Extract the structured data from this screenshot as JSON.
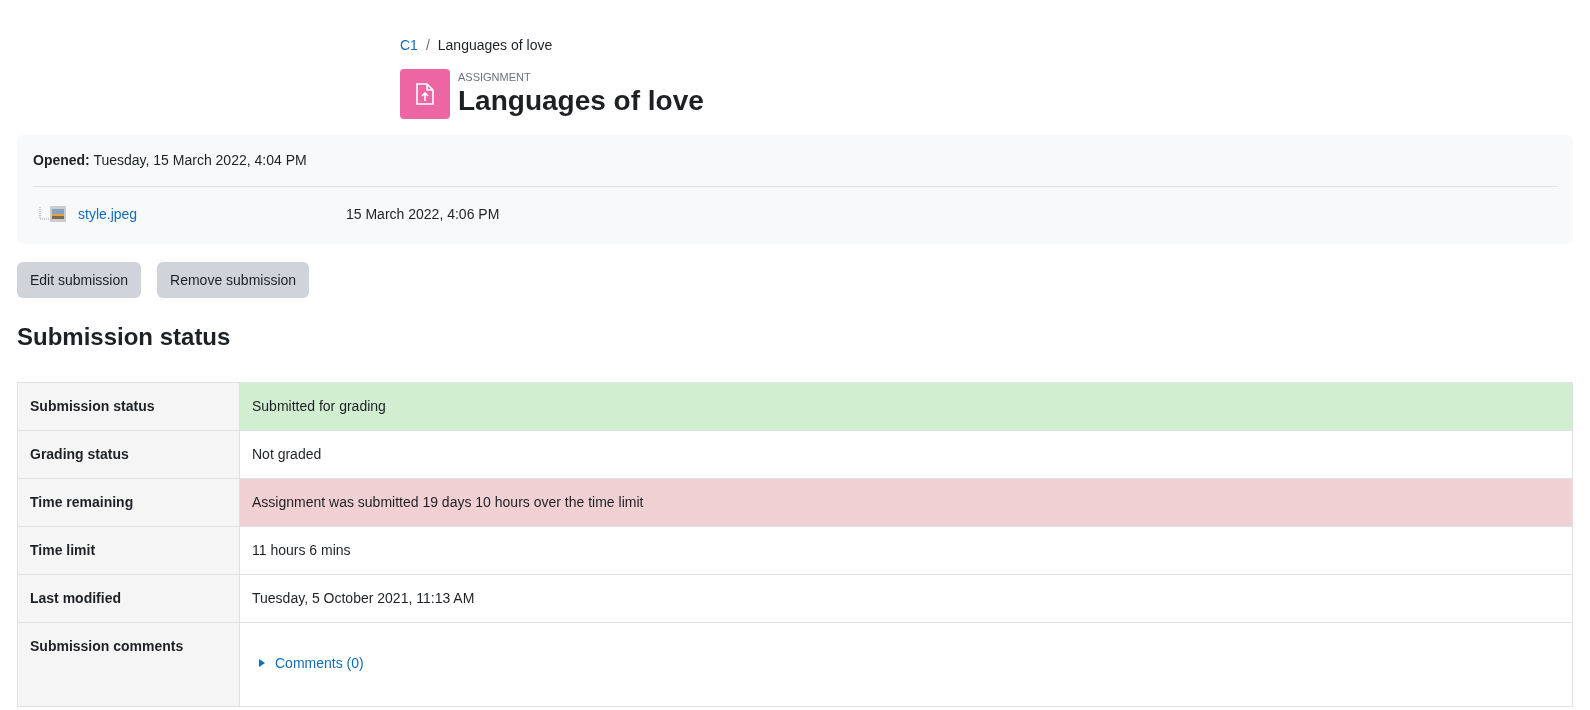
{
  "breadcrumb": [
    {
      "label": "C1",
      "link": true
    },
    {
      "label": "Languages of love",
      "link": false
    }
  ],
  "breadcrumb_separator": "/",
  "header": {
    "kicker": "ASSIGNMENT",
    "title": "Languages of love"
  },
  "dates": {
    "label": "Opened:",
    "value": "Tuesday, 15 March 2022, 4:04 PM"
  },
  "files": [
    {
      "name": "style.jpeg",
      "modified": "15 March 2022, 4:06 PM"
    }
  ],
  "buttons": [
    "Edit submission",
    "Remove submission"
  ],
  "section_title": "Submission status",
  "table": {
    "rows": [
      {
        "label": "Submission status",
        "value": "Submitted for grading",
        "color": "#d1eed1",
        "kind": "text"
      },
      {
        "label": "Grading status",
        "value": "Not graded",
        "kind": "text"
      },
      {
        "label": "Time remaining",
        "value": "Assignment was submitted 19 days 10 hours over the time limit",
        "color": "#f0d0d3",
        "kind": "text"
      },
      {
        "label": "Time limit",
        "value": "11 hours 6 mins",
        "kind": "text"
      },
      {
        "label": "Last modified",
        "value": "Tuesday, 5 October 2021, 11:13 AM",
        "kind": "text"
      },
      {
        "label": "Submission comments",
        "value": "Comments (0)",
        "kind": "comments",
        "expanded": false
      }
    ]
  }
}
